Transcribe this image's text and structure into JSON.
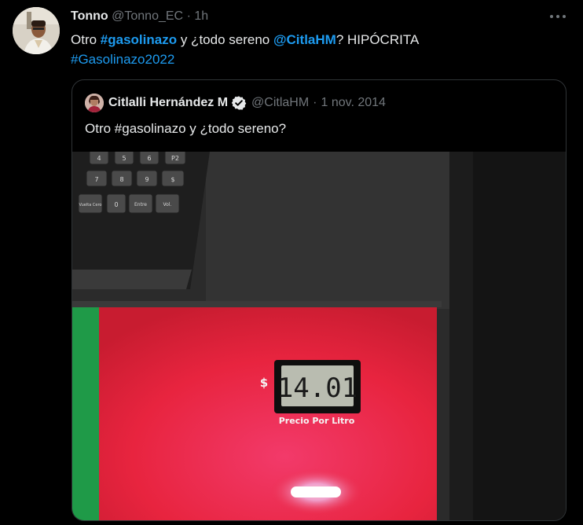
{
  "author": {
    "name": "Tonno",
    "handle": "@Tonno_EC",
    "separator": "·",
    "time": "1h"
  },
  "tweet": {
    "part1": "Otro ",
    "hashtag1": "#gasolinazo",
    "part2": " y ¿todo sereno ",
    "mention": "@CitlaHM",
    "part3": "? HIPÓCRITA",
    "hashtag2": "#Gasolinazo2022"
  },
  "quoted": {
    "name": "Citlalli Hernández M",
    "handle": "@CitlaHM",
    "separator": "·",
    "date": "1 nov. 2014",
    "text": "Otro #gasolinazo y ¿todo sereno?",
    "photo": {
      "keypad_row1": [
        "4",
        "5",
        "6",
        "P2"
      ],
      "keypad_row2": [
        "7",
        "8",
        "9",
        "$"
      ],
      "keypad_row3": [
        "Vuelta Cero",
        "0",
        "Entre",
        "Vol."
      ],
      "currency": "$",
      "price_display": "14.01",
      "price_label": "Precio Por Litro"
    }
  },
  "icons": {
    "more": "more-horizontal-icon",
    "verified": "verified-badge-icon"
  },
  "colors": {
    "background": "#000000",
    "text": "#e7e9ea",
    "muted": "#71767b",
    "link": "#1d9bf0",
    "border": "#2f3336",
    "pump_red": "#e8243f",
    "pump_green": "#1f9a48"
  }
}
